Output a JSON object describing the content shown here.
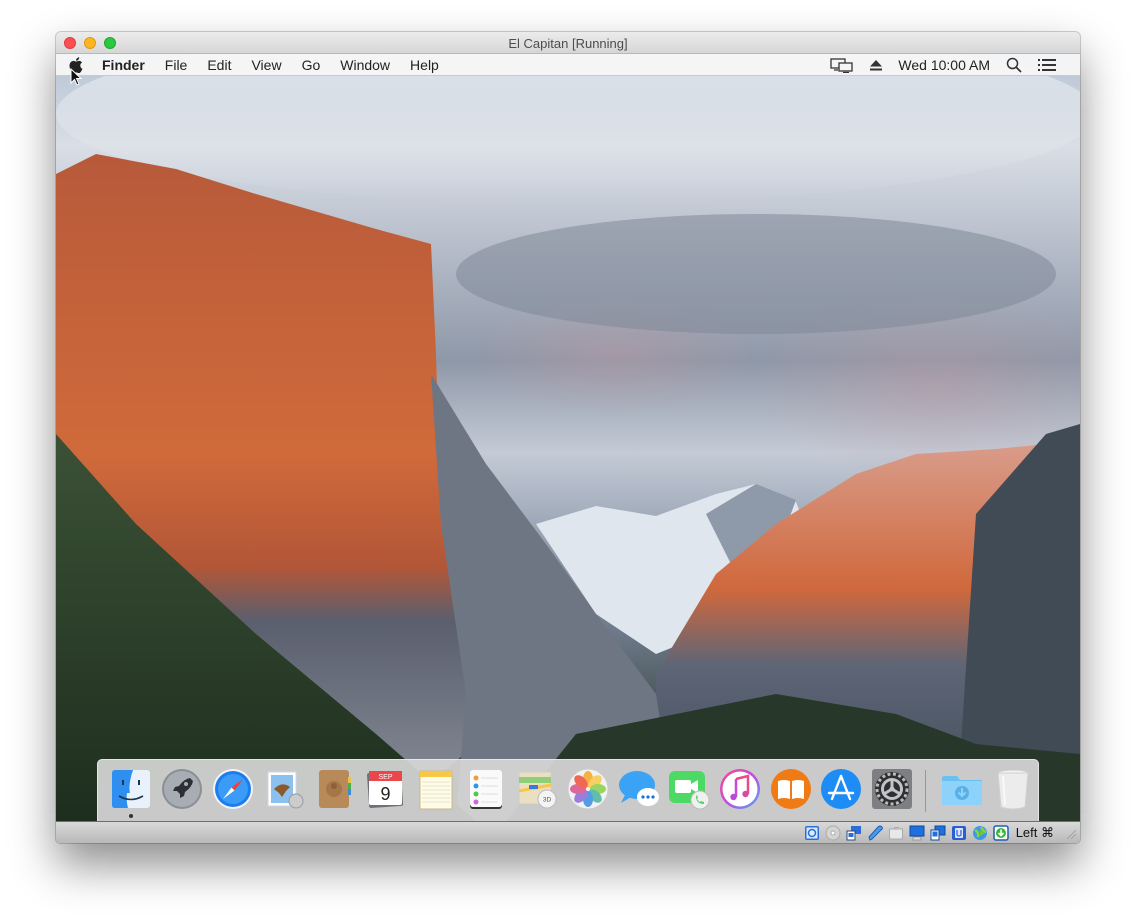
{
  "window": {
    "title": "El Capitan [Running]",
    "buttons": {
      "close": "close",
      "minimize": "minimize",
      "zoom": "zoom"
    }
  },
  "menubar": {
    "apple_icon": "apple-logo-icon",
    "app_name": "Finder",
    "items": [
      "File",
      "Edit",
      "View",
      "Go",
      "Window",
      "Help"
    ],
    "status": {
      "display_icon": "airplay-display-icon",
      "eject_icon": "eject-icon",
      "clock": "Wed 10:00 AM",
      "spotlight_icon": "search-icon",
      "notification_icon": "notification-center-icon"
    }
  },
  "desktop": {
    "wallpaper": "El Capitan (Yosemite valley, granite cliff at sunset)"
  },
  "dock": {
    "apps": [
      {
        "name": "Finder",
        "icon": "finder-icon",
        "running": true
      },
      {
        "name": "Launchpad",
        "icon": "launchpad-icon",
        "running": false
      },
      {
        "name": "Safari",
        "icon": "safari-icon",
        "running": false
      },
      {
        "name": "Mail",
        "icon": "mail-icon",
        "running": false
      },
      {
        "name": "Contacts",
        "icon": "contacts-icon",
        "running": false
      },
      {
        "name": "Calendar",
        "icon": "calendar-icon",
        "running": false,
        "month": "SEP",
        "day": "9"
      },
      {
        "name": "Notes",
        "icon": "notes-icon",
        "running": false
      },
      {
        "name": "Reminders",
        "icon": "reminders-icon",
        "running": false
      },
      {
        "name": "Maps",
        "icon": "maps-icon",
        "running": false,
        "badge": "3D"
      },
      {
        "name": "Photos",
        "icon": "photos-icon",
        "running": false
      },
      {
        "name": "Messages",
        "icon": "messages-icon",
        "running": false
      },
      {
        "name": "FaceTime",
        "icon": "facetime-icon",
        "running": false
      },
      {
        "name": "iTunes",
        "icon": "itunes-icon",
        "running": false
      },
      {
        "name": "iBooks",
        "icon": "ibooks-icon",
        "running": false
      },
      {
        "name": "App Store",
        "icon": "app-store-icon",
        "running": false
      },
      {
        "name": "System Preferences",
        "icon": "system-preferences-icon",
        "running": false
      }
    ],
    "stacks": [
      {
        "name": "Downloads",
        "icon": "downloads-folder-icon"
      },
      {
        "name": "Trash",
        "icon": "trash-icon"
      }
    ]
  },
  "statusbar": {
    "icons": [
      "hard-disk-icon",
      "optical-drive-icon",
      "audio-icon",
      "usb-icon",
      "shared-folders-icon",
      "display-icon",
      "video-capture-icon",
      "cpu-icon",
      "network-icon",
      "mouse-integration-icon"
    ],
    "host_key": "Left ⌘"
  }
}
